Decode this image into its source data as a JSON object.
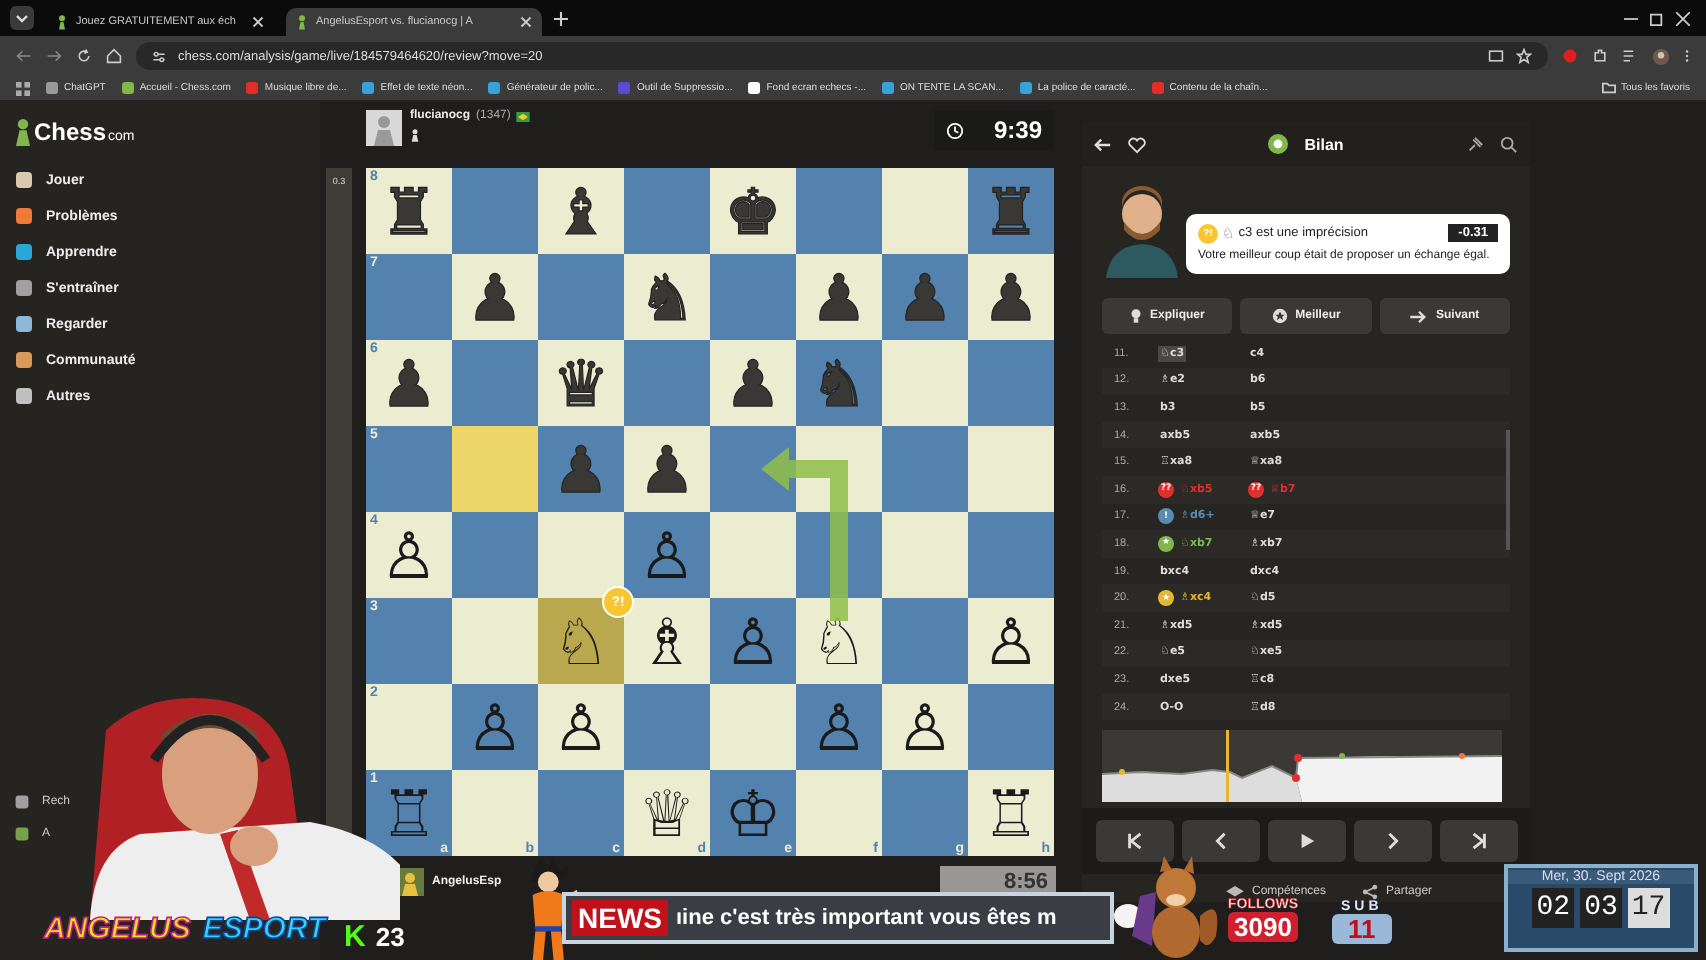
{
  "browser": {
    "tabs": [
      {
        "title": "Jouez GRATUITEMENT aux éch",
        "selected": false
      },
      {
        "title": "AngelusEsport vs. flucianocg | A",
        "selected": true
      }
    ],
    "url": "chess.com/analysis/game/live/184579464620/review?move=20",
    "bookmarks": [
      {
        "label": "ChatGPT",
        "color": "#9a9a9a"
      },
      {
        "label": "Accueil - Chess.com",
        "color": "#81b64c"
      },
      {
        "label": "Musique libre de...",
        "color": "#e52d27"
      },
      {
        "label": "Effet de texte néon...",
        "color": "#3aa0d8"
      },
      {
        "label": "Générateur de polic...",
        "color": "#3aa0d8"
      },
      {
        "label": "Outil de Suppressio...",
        "color": "#5b4bd6"
      },
      {
        "label": "Fond ecran echecs -...",
        "color": "#ffffff"
      },
      {
        "label": "ON TENTE LA SCAN...",
        "color": "#3aa0d8"
      },
      {
        "label": "La police de caracté...",
        "color": "#3aa0d8"
      },
      {
        "label": "Contenu de la chaîn...",
        "color": "#e52d27"
      }
    ],
    "all_bookmarks": "Tous les favoris"
  },
  "sidebar": {
    "logo": "Chess",
    "logo_suffix": "com",
    "items": [
      {
        "label": "Jouer",
        "color": "#d8c8b0"
      },
      {
        "label": "Problèmes",
        "color": "#f07a3a"
      },
      {
        "label": "Apprendre",
        "color": "#2aa6d8"
      },
      {
        "label": "S'entraîner",
        "color": "#a0a0a0"
      },
      {
        "label": "Regarder",
        "color": "#8fb8d8"
      },
      {
        "label": "Communauté",
        "color": "#d89a5a"
      },
      {
        "label": "Autres",
        "color": "#c0c0c0"
      }
    ],
    "bottom_items": [
      {
        "label": "Rech",
        "color": "#a0a0a0"
      },
      {
        "label": "A",
        "color": "#7aa04a"
      }
    ]
  },
  "top_player": {
    "name": "flucianocg",
    "rating": "(1347)",
    "clock": "9:39"
  },
  "eval_bar": {
    "reading": "0.3"
  },
  "board": {
    "ranks": [
      "8",
      "7",
      "6",
      "5",
      "4",
      "3",
      "2",
      "1"
    ],
    "files": [
      "a",
      "b",
      "c",
      "d",
      "e",
      "f",
      "g",
      "h"
    ],
    "rows": [
      [
        {
          "glyph": "♜",
          "white": false
        },
        null,
        {
          "glyph": "♝",
          "white": false
        },
        null,
        {
          "glyph": "♚",
          "white": false
        },
        null,
        null,
        {
          "glyph": "♜",
          "white": false
        }
      ],
      [
        null,
        {
          "glyph": "♟",
          "white": false
        },
        null,
        {
          "glyph": "♞",
          "white": false
        },
        null,
        {
          "glyph": "♟",
          "white": false
        },
        {
          "glyph": "♟",
          "white": false
        },
        {
          "glyph": "♟",
          "white": false
        }
      ],
      [
        {
          "glyph": "♟",
          "white": false
        },
        null,
        {
          "glyph": "♛",
          "white": false
        },
        null,
        {
          "glyph": "♟",
          "white": false
        },
        {
          "glyph": "♞",
          "white": false
        },
        null,
        null
      ],
      [
        null,
        {
          "highlighted": true
        },
        {
          "glyph": "♟",
          "white": false
        },
        {
          "glyph": "♟",
          "white": false
        },
        {
          "arrow_end": true
        },
        null,
        null,
        null
      ],
      [
        {
          "glyph": "♙",
          "white": true
        },
        null,
        null,
        {
          "glyph": "♙",
          "white": true
        },
        null,
        null,
        null,
        null
      ],
      [
        null,
        null,
        {
          "glyph": "♘",
          "white": true,
          "highlighted": true,
          "badge": "?!"
        },
        {
          "glyph": "♗",
          "white": true
        },
        {
          "glyph": "♙",
          "white": true
        },
        {
          "glyph": "♘",
          "white": true,
          "arrow_start": true
        },
        null,
        {
          "glyph": "♙",
          "white": true
        }
      ],
      [
        null,
        {
          "glyph": "♙",
          "white": true
        },
        {
          "glyph": "♙",
          "white": true
        },
        null,
        null,
        {
          "glyph": "♙",
          "white": true
        },
        {
          "glyph": "♙",
          "white": true
        },
        null
      ],
      [
        {
          "glyph": "♖",
          "white": true
        },
        null,
        null,
        {
          "glyph": "♕",
          "white": true
        },
        {
          "glyph": "♔",
          "white": true
        },
        null,
        null,
        {
          "glyph": "♖",
          "white": true
        }
      ]
    ]
  },
  "bottom_player": {
    "name": "AngelusEsp",
    "clock": "8:56"
  },
  "review": {
    "title": "Bilan",
    "coach": {
      "badge": "?!",
      "piece": "♘",
      "text": "c3 est une imprécision",
      "eval": "-0.31",
      "advice": "Votre meilleur coup était de proposer un échange égal."
    },
    "buttons": [
      {
        "label": "Expliquer",
        "kind": "bulb"
      },
      {
        "label": "Meilleur",
        "kind": "star"
      },
      {
        "label": "Suivant",
        "kind": "arrow"
      }
    ],
    "moves": [
      {
        "number": "11.",
        "white": {
          "piece": "♘",
          "san": "c3",
          "selected": true
        },
        "black": {
          "san": "c4",
          "selected": false
        }
      },
      {
        "number": "12.",
        "white": {
          "piece": "♗",
          "san": "e2",
          "selected": false
        },
        "black": {
          "san": "b6",
          "selected": false
        }
      },
      {
        "number": "13.",
        "white": {
          "san": "b3",
          "selected": false
        },
        "black": {
          "san": "b5",
          "selected": false
        }
      },
      {
        "number": "14.",
        "white": {
          "san": "axb5",
          "selected": false
        },
        "black": {
          "san": "axb5",
          "selected": false
        }
      },
      {
        "number": "15.",
        "white": {
          "piece": "♖",
          "san": "xa8",
          "selected": false
        },
        "black": {
          "piece": "♕",
          "san": "xa8",
          "selected": false
        }
      },
      {
        "number": "16.",
        "white": {
          "piece": "♘",
          "san": "xb5",
          "selected": false,
          "badge": {
            "text": "??",
            "color": "#e02f2f"
          }
        },
        "black": {
          "piece": "♕",
          "san": "b7",
          "selected": false,
          "badge": {
            "text": "??",
            "color": "#e02f2f"
          }
        }
      },
      {
        "number": "17.",
        "white": {
          "piece": "♗",
          "san": "d6+",
          "selected": false,
          "badge": {
            "text": "!",
            "color": "#5c8bb0"
          }
        },
        "black": {
          "piece": "♕",
          "san": "e7",
          "selected": false
        }
      },
      {
        "number": "18.",
        "white": {
          "piece": "♘",
          "san": "xb7",
          "selected": false,
          "badge": {
            "text": "★",
            "color": "#81b64c"
          }
        },
        "black": {
          "piece": "♗",
          "san": "xb7",
          "selected": false
        }
      },
      {
        "number": "19.",
        "white": {
          "san": "bxc4",
          "selected": false
        },
        "black": {
          "san": "dxc4",
          "selected": false
        }
      },
      {
        "number": "20.",
        "white": {
          "piece": "♗",
          "san": "xc4",
          "selected": false,
          "badge": {
            "text": "★",
            "color": "#e6b82e"
          }
        },
        "black": {
          "piece": "♘",
          "san": "d5",
          "selected": false
        }
      },
      {
        "number": "21.",
        "white": {
          "piece": "♗",
          "san": "xd5",
          "selected": false
        },
        "black": {
          "piece": "♗",
          "san": "xd5",
          "selected": false
        }
      },
      {
        "number": "22.",
        "white": {
          "piece": "♘",
          "san": "e5",
          "selected": false
        },
        "black": {
          "piece": "♘",
          "san": "xe5",
          "selected": false
        }
      },
      {
        "number": "23.",
        "white": {
          "san": "dxe5",
          "selected": false
        },
        "black": {
          "piece": "♖",
          "san": "c8",
          "selected": false
        }
      },
      {
        "number": "24.",
        "white": {
          "san": "O-O",
          "selected": false
        },
        "black": {
          "piece": "♖",
          "san": "d8",
          "selected": false
        }
      }
    ],
    "nav": [
      {
        "kind": "first"
      },
      {
        "kind": "prev"
      },
      {
        "kind": "play"
      },
      {
        "kind": "next"
      },
      {
        "kind": "last"
      }
    ],
    "footer": [
      {
        "label": "Compétences",
        "kind": "skills"
      },
      {
        "label": "Partager",
        "kind": "share"
      }
    ]
  },
  "stream": {
    "brand": [
      "ANGELUS",
      "ESPORT"
    ],
    "kick_logo": "K",
    "kick_count": "23",
    "news_label": "NEWS",
    "news_text": "ıine c'est très important vous êtes m",
    "follows_label": "FOLLOWS",
    "follows": "3090",
    "sub_label": "SUB",
    "subs": "11",
    "date": "Mer, 30. Sept 2026",
    "time": [
      "02",
      "03",
      "17"
    ]
  }
}
